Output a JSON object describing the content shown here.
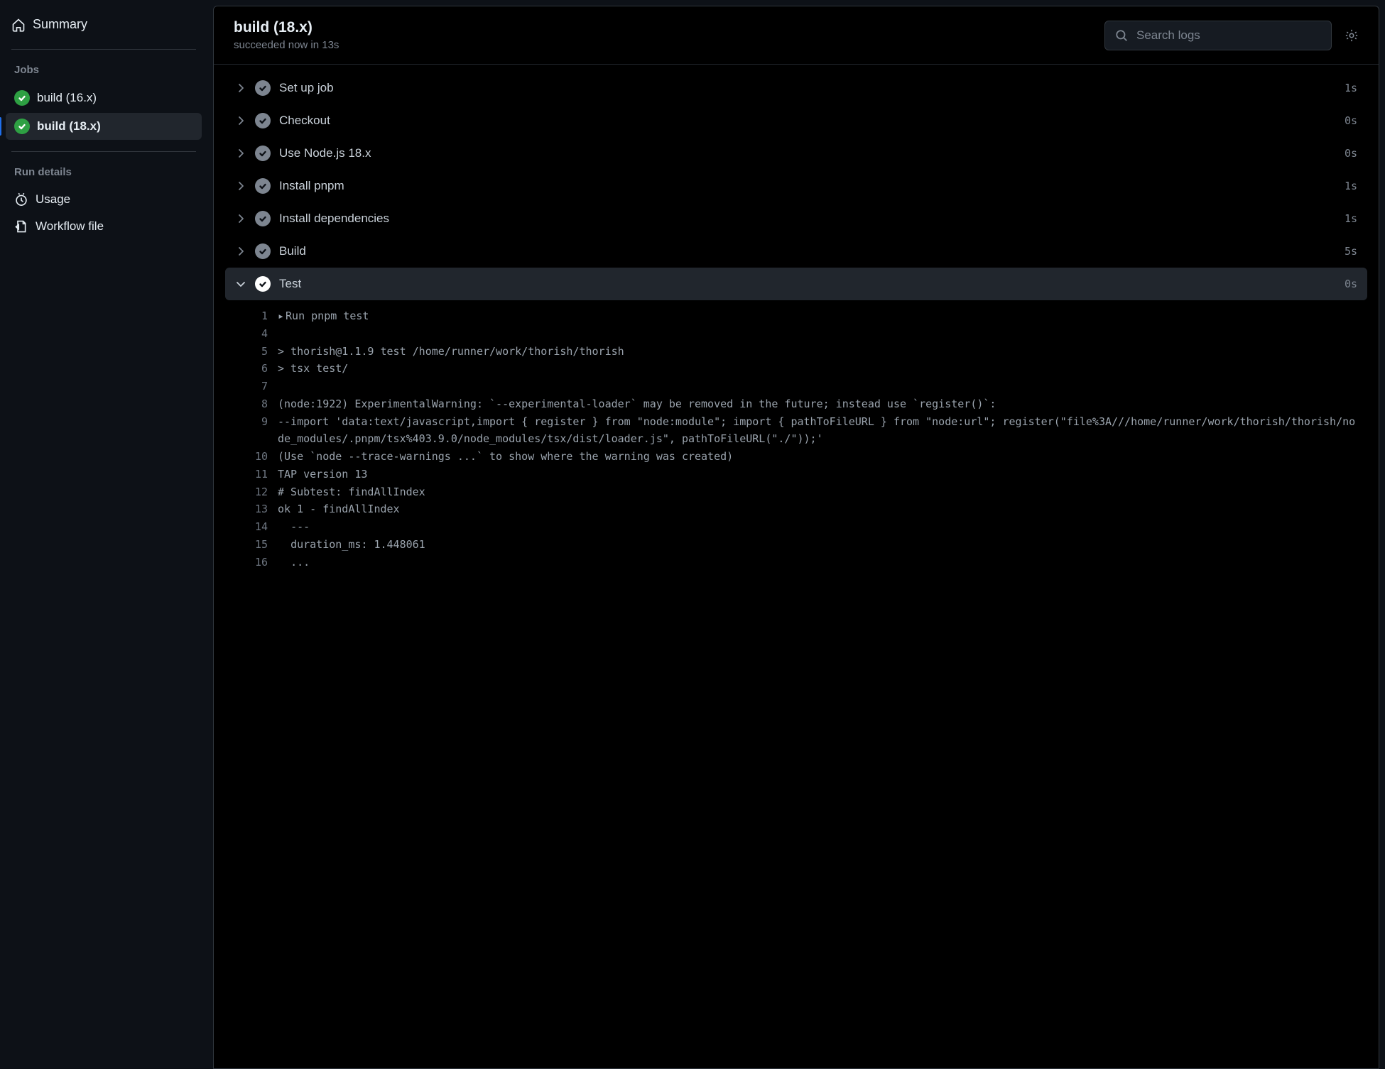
{
  "sidebar": {
    "summary_label": "Summary",
    "jobs_heading": "Jobs",
    "jobs": [
      {
        "label": "build (16.x)",
        "active": false
      },
      {
        "label": "build (18.x)",
        "active": true
      }
    ],
    "rundetails_heading": "Run details",
    "rundetails": [
      {
        "label": "Usage",
        "slug": "usage"
      },
      {
        "label": "Workflow file",
        "slug": "workflow-file"
      }
    ]
  },
  "header": {
    "title": "build (18.x)",
    "subtitle": "succeeded now in 13s",
    "search_placeholder": "Search logs"
  },
  "steps": [
    {
      "name": "Set up job",
      "time": "1s",
      "expanded": false
    },
    {
      "name": "Checkout",
      "time": "0s",
      "expanded": false
    },
    {
      "name": "Use Node.js 18.x",
      "time": "0s",
      "expanded": false
    },
    {
      "name": "Install pnpm",
      "time": "1s",
      "expanded": false
    },
    {
      "name": "Install dependencies",
      "time": "1s",
      "expanded": false
    },
    {
      "name": "Build",
      "time": "5s",
      "expanded": false
    },
    {
      "name": "Test",
      "time": "0s",
      "expanded": true
    }
  ],
  "log": [
    {
      "n": "1",
      "t": "Run pnpm test",
      "caret": true
    },
    {
      "n": "4",
      "t": ""
    },
    {
      "n": "5",
      "t": "> thorish@1.1.9 test /home/runner/work/thorish/thorish"
    },
    {
      "n": "6",
      "t": "> tsx test/"
    },
    {
      "n": "7",
      "t": ""
    },
    {
      "n": "8",
      "t": "(node:1922) ExperimentalWarning: `--experimental-loader` may be removed in the future; instead use `register()`:"
    },
    {
      "n": "9",
      "t": "--import 'data:text/javascript,import { register } from \"node:module\"; import { pathToFileURL } from \"node:url\"; register(\"file%3A///home/runner/work/thorish/thorish/node_modules/.pnpm/tsx%403.9.0/node_modules/tsx/dist/loader.js\", pathToFileURL(\"./\"));'"
    },
    {
      "n": "10",
      "t": "(Use `node --trace-warnings ...` to show where the warning was created)"
    },
    {
      "n": "11",
      "t": "TAP version 13"
    },
    {
      "n": "12",
      "t": "# Subtest: findAllIndex"
    },
    {
      "n": "13",
      "t": "ok 1 - findAllIndex"
    },
    {
      "n": "14",
      "t": "  ---"
    },
    {
      "n": "15",
      "t": "  duration_ms: 1.448061"
    },
    {
      "n": "16",
      "t": "  ..."
    }
  ]
}
